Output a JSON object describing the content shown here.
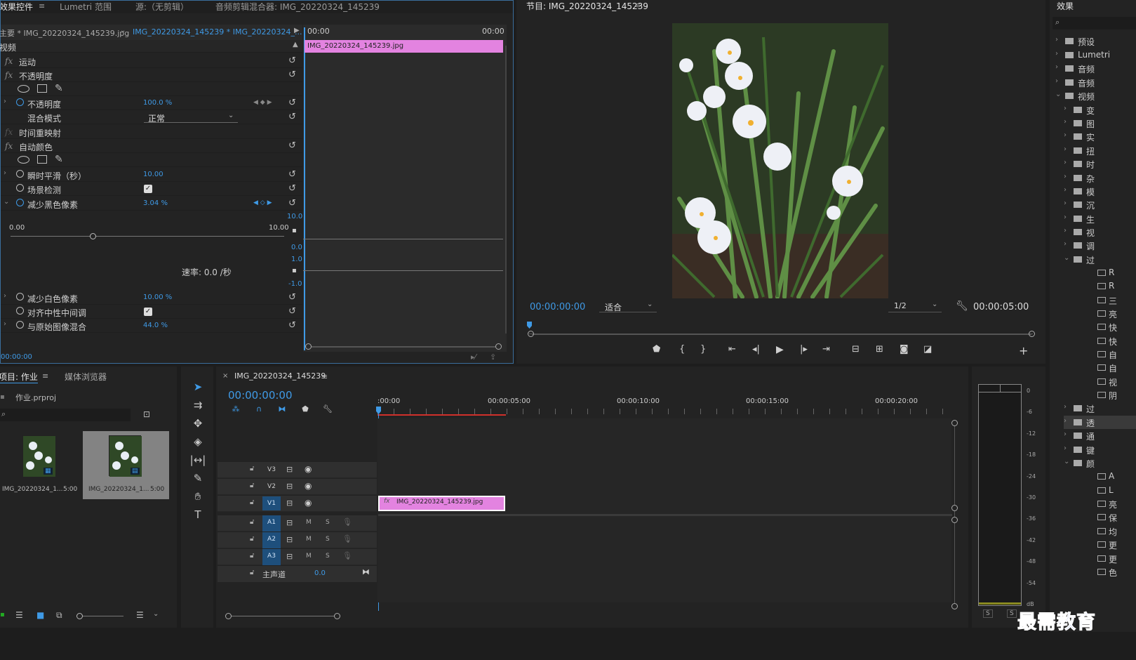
{
  "effect_controls": {
    "tabs": [
      "效果控件",
      "Lumetri 范围",
      "源:（无剪辑）",
      "音频剪辑混合器: IMG_20220324_145239"
    ],
    "source_clip": "主要 * IMG_20220324_145239.jpg",
    "sequence_clip": "IMG_20220324_145239 * IMG_20220324_...",
    "time_start": "00:00",
    "time_end": "00:00",
    "clip_bar_label": "IMG_20220324_145239.jpg",
    "section_video": "视频",
    "fx_motion": "运动",
    "fx_opacity": "不透明度",
    "opacity_label": "不透明度",
    "opacity_value": "100.0 %",
    "blend_label": "混合模式",
    "blend_value": "正常",
    "time_remap": "时间重映射",
    "auto_color": "自动颜色",
    "smooth_label": "瞬时平滑（秒）",
    "smooth_value": "10.00",
    "scene_label": "场景检测",
    "black_label": "减少黑色像素",
    "black_value": "3.04 %",
    "slider_min": "0.00",
    "slider_max": "10.00",
    "graph_top": "10.0",
    "graph_zero": "0.0",
    "graph_one": "1.0",
    "graph_neg": "-1.0",
    "velocity_label": "速率: 0.0 /秒",
    "white_label": "减少白色像素",
    "white_value": "10.00 %",
    "snap_label": "对齐中性中间调",
    "mix_label": "与原始图像混合",
    "mix_value": "44.0 %",
    "current_time": "00:00:00"
  },
  "program": {
    "title": "节目: IMG_20220324_145239",
    "timecode": "00:00:00:00",
    "fit": "适合",
    "resolution": "1/2",
    "duration": "00:00:05:00"
  },
  "effects": {
    "title": "效果",
    "folders": [
      "预设",
      "Lumetri",
      "音频",
      "音频",
      "视频",
      "变",
      "图",
      "实",
      "扭",
      "时",
      "杂",
      "模",
      "沉",
      "生",
      "视",
      "调",
      "过",
      "R",
      "R",
      "三",
      "亮",
      "快",
      "快",
      "自",
      "自",
      "视",
      "阴",
      "过",
      "透",
      "通",
      "键",
      "颜",
      "A",
      "L",
      "亮",
      "保",
      "均",
      "更",
      "更",
      "色"
    ]
  },
  "project": {
    "tabs": [
      "项目: 作业",
      "媒体浏览器"
    ],
    "file": "作业.prproj",
    "items": [
      {
        "name": "IMG_20220324_1...",
        "duration": "5:00"
      },
      {
        "name": "IMG_20220324_1...",
        "duration": "5:00"
      }
    ]
  },
  "timeline": {
    "title": "IMG_20220324_145239",
    "timecode": "00:00:00:00",
    "ruler": [
      ":00:00",
      "00:00:05:00",
      "00:00:10:00",
      "00:00:15:00",
      "00:00:20:00"
    ],
    "video_tracks": [
      "V3",
      "V2",
      "V1"
    ],
    "audio_tracks": [
      "A1",
      "A2",
      "A3"
    ],
    "master_label": "主声道",
    "master_value": "0.0",
    "clip_label": "IMG_20220324_145239.jpg"
  },
  "meter": {
    "ticks": [
      "0",
      "-6",
      "-12",
      "-18",
      "-24",
      "-30",
      "-36",
      "-42",
      "-48",
      "-54",
      "dB"
    ],
    "solo": [
      "S",
      "S"
    ]
  },
  "watermark": "最需教育",
  "colors": {
    "accent": "#3f9ae6",
    "clip": "#e383e0",
    "bg": "#232323"
  }
}
